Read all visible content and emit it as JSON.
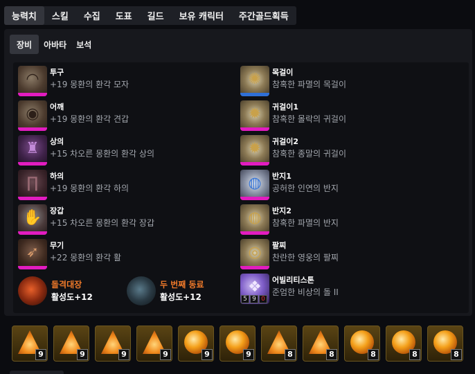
{
  "tabs": [
    {
      "label": "능력치",
      "active": true
    },
    {
      "label": "스킬"
    },
    {
      "label": "수집"
    },
    {
      "label": "도표"
    },
    {
      "label": "길드"
    },
    {
      "label": "보유 캐릭터"
    },
    {
      "label": "주간골드획득"
    }
  ],
  "subtabs": [
    {
      "label": "장비",
      "active": true
    },
    {
      "label": "아바타"
    },
    {
      "label": "보석"
    }
  ],
  "equipment": [
    {
      "slot": "투구",
      "name": "+19 몽환의 환각 모자",
      "bar_color": "#e21cc0",
      "icon": "helmet-icon"
    },
    {
      "slot": "어깨",
      "name": "+19 몽환의 환각 견갑",
      "bar_color": "#e21cc0",
      "icon": "shoulder-icon"
    },
    {
      "slot": "상의",
      "name": "+15 차오른 몽환의 환각 상의",
      "bar_color": "#e21cc0",
      "icon": "chest-armor-icon"
    },
    {
      "slot": "하의",
      "name": "+19 몽환의 환각 하의",
      "bar_color": "#e21cc0",
      "icon": "pants-icon"
    },
    {
      "slot": "장갑",
      "name": "+15 차오른 몽환의 환각 장갑",
      "bar_color": "#e21cc0",
      "icon": "gloves-icon"
    },
    {
      "slot": "무기",
      "name": "+22 몽환의 환각 활",
      "bar_color": "#e21cc0",
      "icon": "bow-icon"
    }
  ],
  "accessories": [
    {
      "slot": "목걸이",
      "name": "참혹한 파멸의 목걸이",
      "bar_color": "#2f6fd6",
      "icon": "necklace-icon"
    },
    {
      "slot": "귀걸이1",
      "name": "참혹한 몰락의 귀걸이",
      "bar_color": "#e21cc0",
      "icon": "earring-icon"
    },
    {
      "slot": "귀걸이2",
      "name": "참혹한 종말의 귀걸이",
      "bar_color": "#e21cc0",
      "icon": "earring-icon"
    },
    {
      "slot": "반지1",
      "name": "공허한 인연의 반지",
      "bar_color": "#e21cc0",
      "icon": "ring-icon"
    },
    {
      "slot": "반지2",
      "name": "참혹한 파멸의 반지",
      "bar_color": "#e21cc0",
      "icon": "ring-icon"
    },
    {
      "slot": "팔찌",
      "name": "찬란한 영웅의 팔찌",
      "bar_color": "#e21cc0",
      "icon": "bracelet-icon"
    }
  ],
  "extras": [
    {
      "title": "돌격대장",
      "value": "활성도+12",
      "icon": "assault-captain-icon"
    },
    {
      "title": "두 번째 동료",
      "value": "활성도+12",
      "icon": "companion-icon"
    }
  ],
  "ability_stone": {
    "slot": "어빌리티스톤",
    "name": "준엄한 비상의 돌 II",
    "points": [
      "5",
      "9",
      "0"
    ],
    "icon": "ability-stone-icon"
  },
  "gems": [
    {
      "level": "9",
      "shape": "tri"
    },
    {
      "level": "9",
      "shape": "tri"
    },
    {
      "level": "9",
      "shape": "tri"
    },
    {
      "level": "9",
      "shape": "tri"
    },
    {
      "level": "9",
      "shape": "orb"
    },
    {
      "level": "9",
      "shape": "orb"
    },
    {
      "level": "8",
      "shape": "tri"
    },
    {
      "level": "8",
      "shape": "tri"
    },
    {
      "level": "8",
      "shape": "orb"
    },
    {
      "level": "8",
      "shape": "orb"
    },
    {
      "level": "8",
      "shape": "orb"
    }
  ]
}
